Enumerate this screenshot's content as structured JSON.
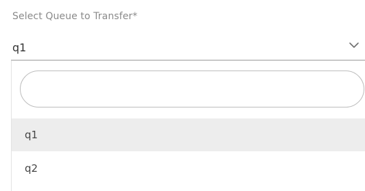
{
  "transfer_form": {
    "queue_field": {
      "label": "Select Queue to Transfer*",
      "selected_value": "q1",
      "chevron_icon": "chevron-down-icon"
    },
    "dropdown": {
      "search": {
        "value": "",
        "placeholder": ""
      },
      "options": [
        {
          "label": "q1",
          "selected": true
        },
        {
          "label": "q2",
          "selected": false
        }
      ]
    }
  },
  "colors": {
    "label_text": "#8a8a8a",
    "value_text": "#333333",
    "selected_option_bg": "#ededed",
    "underline": "#c8c8c8"
  }
}
